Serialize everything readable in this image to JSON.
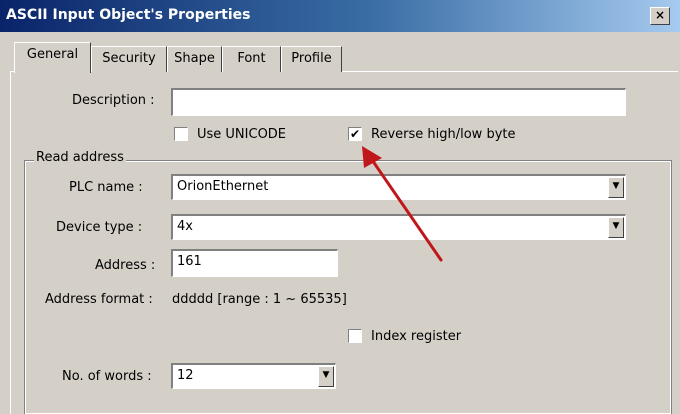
{
  "window": {
    "title": "ASCII Input Object's Properties",
    "close_label": "×"
  },
  "tabs": [
    {
      "label": "General"
    },
    {
      "label": "Security"
    },
    {
      "label": "Shape"
    },
    {
      "label": "Font"
    },
    {
      "label": "Profile"
    }
  ],
  "general": {
    "description_label": "Description :",
    "description_value": "",
    "use_unicode_label": "Use UNICODE",
    "use_unicode_checked": false,
    "reverse_label": "Reverse high/low byte",
    "reverse_checked": true
  },
  "read_address": {
    "group_label": "Read address",
    "plc_name_label": "PLC name :",
    "plc_name_value": "OrionEthernet",
    "device_type_label": "Device type :",
    "device_type_value": "4x",
    "address_label": "Address :",
    "address_value": "161",
    "address_format_label": "Address format :",
    "address_format_value": "ddddd [range : 1 ~ 65535]",
    "index_register_label": "Index register",
    "index_register_checked": false,
    "words_label": "No. of words :",
    "words_value": "12"
  },
  "annotation": {
    "arrow_color": "#c0171a"
  },
  "glyphs": {
    "check": "✔",
    "dropdown": "▼"
  }
}
